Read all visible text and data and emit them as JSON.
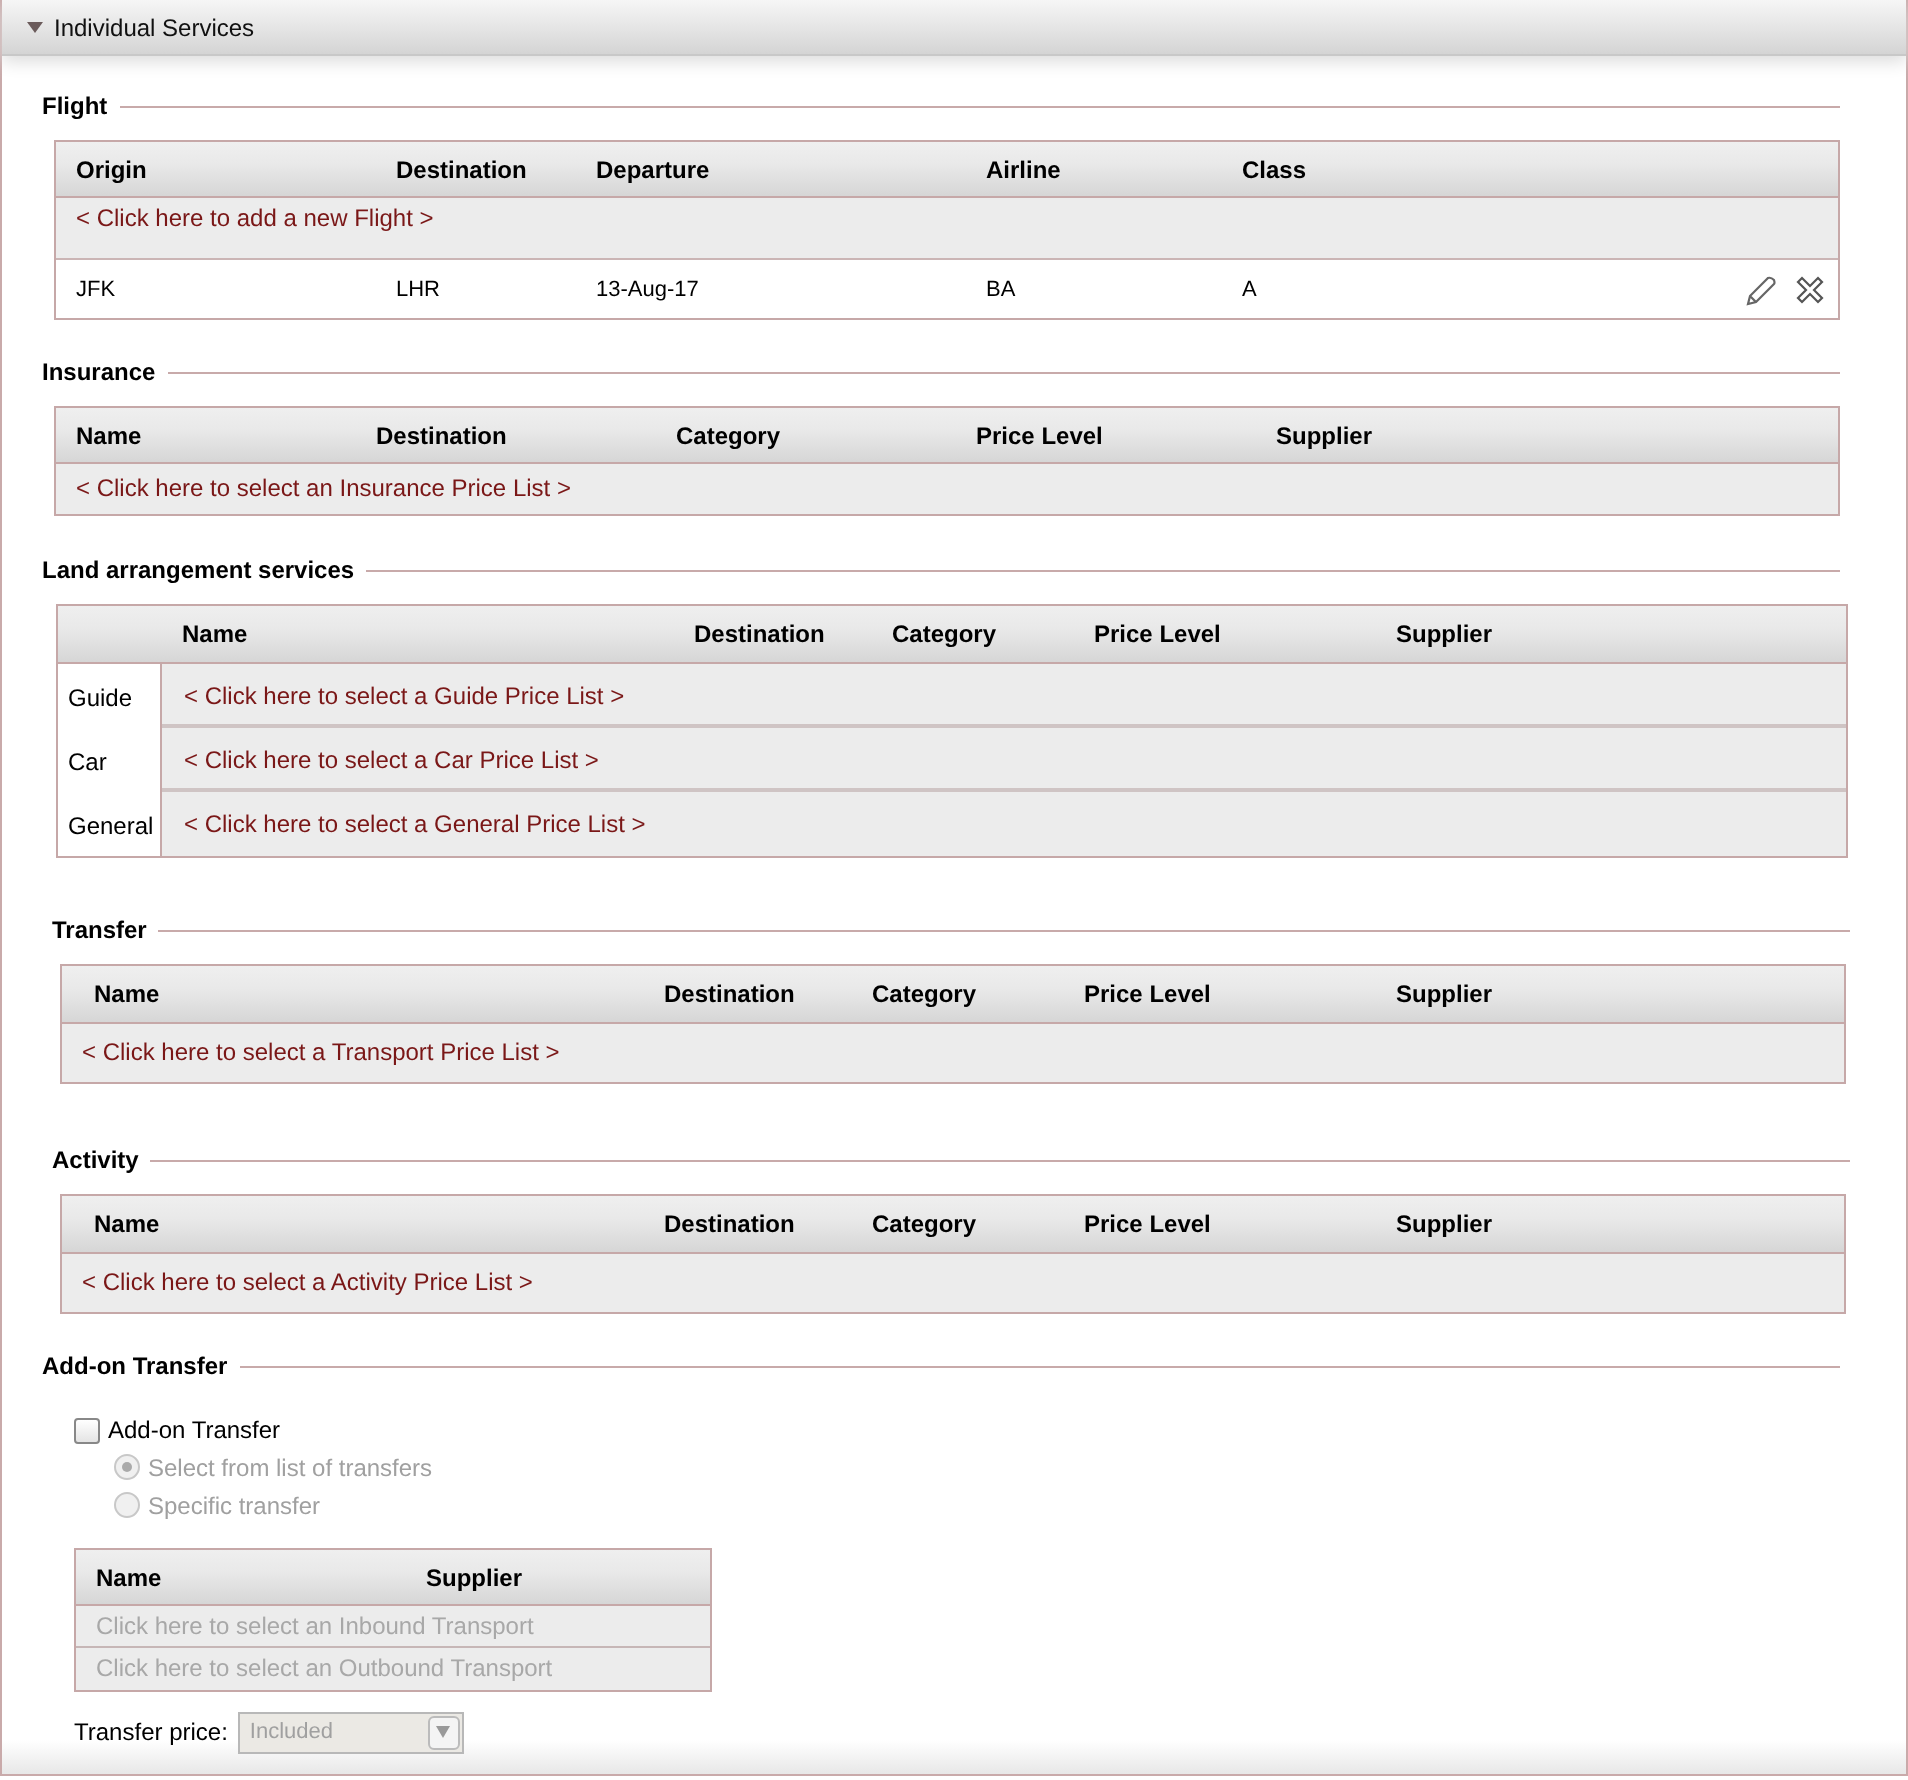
{
  "panel": {
    "title": "Individual Services",
    "expanded": true
  },
  "sections": [
    {
      "kind": "flight",
      "legend": "Flight",
      "columns": [
        "Origin",
        "Destination",
        "Departure",
        "Airline",
        "Class"
      ],
      "add_link": "< Click here to add a new Flight >",
      "rows": [
        {
          "cells": [
            "JFK",
            "LHR",
            "13-Aug-17",
            "BA",
            "A"
          ]
        }
      ]
    },
    {
      "kind": "price_list",
      "legend": "Insurance",
      "columns": [
        "Name",
        "Destination",
        "Category",
        "Price Level",
        "Supplier"
      ],
      "add_link": "< Click here to select an Insurance Price List >"
    },
    {
      "kind": "land",
      "legend": "Land arrangement services",
      "columns": [
        "Name",
        "Destination",
        "Category",
        "Price Level",
        "Supplier"
      ],
      "rows": [
        {
          "label": "Guide",
          "link": "< Click here to select a Guide Price List >"
        },
        {
          "label": "Car",
          "link": "< Click here to select a Car Price List >"
        },
        {
          "label": "General",
          "link": "< Click here to select a General Price List >"
        }
      ]
    },
    {
      "kind": "price_list",
      "legend": "Transfer",
      "columns": [
        "Name",
        "Destination",
        "Category",
        "Price Level",
        "Supplier"
      ],
      "add_link": "< Click here to select a Transport Price List >"
    },
    {
      "kind": "price_list",
      "legend": "Activity",
      "columns": [
        "Name",
        "Destination",
        "Category",
        "Price Level",
        "Supplier"
      ],
      "add_link": "< Click here to select a Activity Price List >"
    },
    {
      "kind": "addon",
      "legend": "Add-on Transfer",
      "checkbox": {
        "label": "Add-on Transfer",
        "checked": false
      },
      "options": [
        {
          "label": "Select from list of transfers",
          "selected": true,
          "disabled": true
        },
        {
          "label": "Specific transfer",
          "selected": false,
          "disabled": true
        }
      ],
      "columns": [
        "Name",
        "Supplier"
      ],
      "links": [
        "Click here to select an Inbound Transport",
        "Click here to select an Outbound Transport"
      ],
      "table_disabled": true,
      "price": {
        "label": "Transfer price:",
        "value": "Included",
        "disabled": true
      }
    }
  ]
}
